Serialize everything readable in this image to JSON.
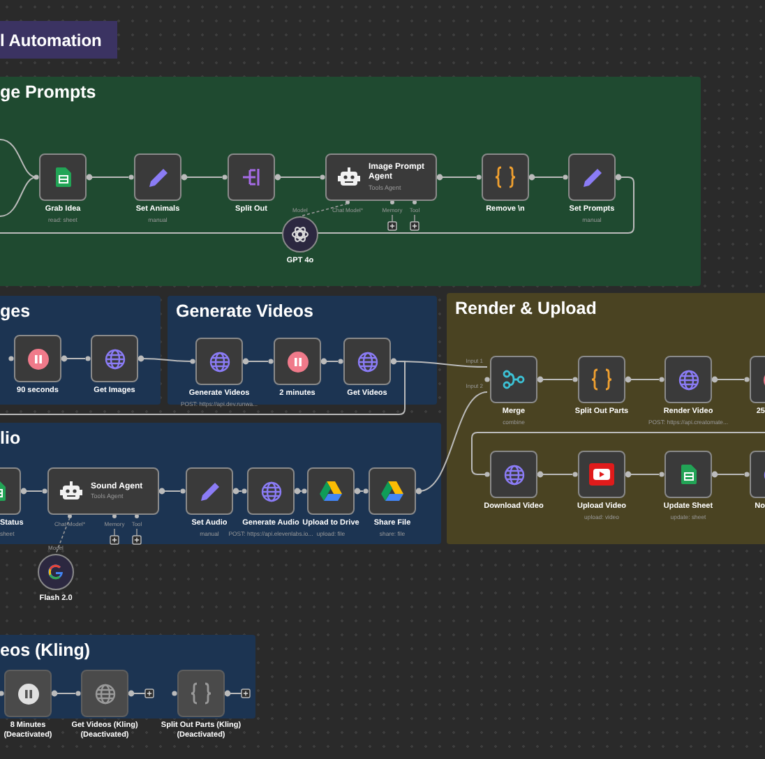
{
  "title_tag": {
    "text": "l Automation"
  },
  "groups": [
    {
      "title": "ge Prompts",
      "color": "#1f4a30",
      "nodes": [
        {
          "kind": "sheet",
          "label": "Grab Idea",
          "sublabel": "read: sheet",
          "disabled": false
        },
        {
          "kind": "edit",
          "label": "Set Animals",
          "sublabel": "manual",
          "disabled": false
        },
        {
          "kind": "split",
          "label": "Split Out",
          "disabled": false
        },
        {
          "kind": "agent",
          "label": "Image Prompt Agent",
          "subtitle": "Tools Agent",
          "ports": [
            "Chat Model*",
            "Memory",
            "Tool"
          ],
          "disabled": false
        },
        {
          "kind": "code",
          "label": "Remove \\n",
          "disabled": false
        },
        {
          "kind": "edit",
          "label": "Set Prompts",
          "sublabel": "manual",
          "disabled": false
        }
      ],
      "models": [
        {
          "kind": "openai",
          "port_label": "Model",
          "label": "GPT 4o"
        }
      ]
    },
    {
      "title": "ges",
      "color": "#1c3452",
      "nodes": [
        {
          "kind": "wait",
          "label": "90 seconds",
          "disabled": false
        },
        {
          "kind": "http",
          "label": "Get Images",
          "disabled": false
        }
      ]
    },
    {
      "title": "Generate Videos",
      "color": "#1c3452",
      "nodes": [
        {
          "kind": "http",
          "label": "Generate Videos",
          "sublabel": "POST: https://api.dev.runwa...",
          "disabled": false
        },
        {
          "kind": "wait",
          "label": "2 minutes",
          "disabled": false
        },
        {
          "kind": "http",
          "label": "Get Videos",
          "disabled": false
        }
      ]
    },
    {
      "title": "lio",
      "color": "#1c3452",
      "nodes": [
        {
          "kind": "sheet",
          "label": "Status",
          "sublabel": "sheet",
          "disabled": false
        },
        {
          "kind": "agent",
          "label": "Sound Agent",
          "subtitle": "Tools Agent",
          "ports": [
            "Chat Model*",
            "Memory",
            "Tool"
          ],
          "disabled": false
        },
        {
          "kind": "edit",
          "label": "Set Audio",
          "sublabel": "manual",
          "disabled": false
        },
        {
          "kind": "http",
          "label": "Generate Audio",
          "sublabel": "POST: https://api.elevenlabs.io...",
          "disabled": false
        },
        {
          "kind": "drive",
          "label": "Upload to Drive",
          "sublabel": "upload: file",
          "disabled": false
        },
        {
          "kind": "drive",
          "label": "Share File",
          "sublabel": "share: file",
          "disabled": false
        }
      ],
      "models": [
        {
          "kind": "google",
          "port_label": "Model",
          "label": "Flash 2.0"
        }
      ]
    },
    {
      "title": "Render & Upload",
      "color": "#4a4322",
      "nodes": [
        {
          "kind": "merge",
          "label": "Merge",
          "sublabel": "combine",
          "inputs": [
            "Input 1",
            "Input 2"
          ],
          "disabled": false
        },
        {
          "kind": "code",
          "label": "Split Out Parts",
          "disabled": false
        },
        {
          "kind": "http",
          "label": "Render Video",
          "sublabel": "POST: https://api.creatomate...",
          "disabled": false
        },
        {
          "kind": "wait",
          "label": "25",
          "disabled": false
        },
        {
          "kind": "http",
          "label": "Download Video",
          "disabled": false
        },
        {
          "kind": "youtube",
          "label": "Upload Video",
          "sublabel": "upload: video",
          "disabled": false
        },
        {
          "kind": "sheet",
          "label": "Update Sheet",
          "sublabel": "update: sheet",
          "disabled": false
        },
        {
          "kind": "http",
          "label": "No",
          "disabled": false
        }
      ]
    },
    {
      "title": "eos (Kling)",
      "color": "#1c3452",
      "nodes": [
        {
          "kind": "wait",
          "label": "8 Minutes",
          "note": "(Deactivated)",
          "disabled": true
        },
        {
          "kind": "http",
          "label": "Get Videos (Kling)",
          "note": "(Deactivated)",
          "disabled": true
        },
        {
          "kind": "code",
          "label": "Split Out Parts (Kling)",
          "note": "(Deactivated)",
          "disabled": true
        }
      ]
    }
  ]
}
